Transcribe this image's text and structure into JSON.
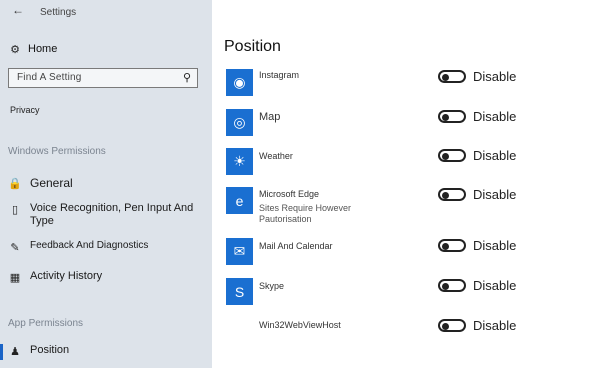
{
  "window": {
    "title": "Settings"
  },
  "sidebar": {
    "home_label": "Home",
    "search_placeholder": "Find A Setting",
    "privacy_label": "Privacy",
    "windows_permissions_header": "Windows Permissions",
    "app_permissions_header": "App Permissions",
    "items": [
      {
        "label": "General"
      },
      {
        "label": "Voice Recognition, Pen Input And Type"
      },
      {
        "label": "Feedback And Diagnostics"
      },
      {
        "label": "Activity History"
      },
      {
        "label": "Position"
      }
    ]
  },
  "main": {
    "title": "Position",
    "apps": [
      {
        "name": "Instagram",
        "state": "Disable",
        "icon": "instagram-icon"
      },
      {
        "name": "Map",
        "state": "Disable",
        "icon": "map-icon"
      },
      {
        "name": "Weather",
        "state": "Disable",
        "icon": "weather-icon"
      },
      {
        "name": "Microsoft Edge",
        "sub": "Sites Require However Pautorisation",
        "state": "Disable",
        "icon": "edge-icon"
      },
      {
        "name": "Mail And Calendar",
        "state": "Disable",
        "icon": "mail-icon"
      },
      {
        "name": "Skype",
        "state": "Disable",
        "icon": "skype-icon"
      },
      {
        "name": "Win32WebViewHost",
        "state": "Disable"
      }
    ]
  },
  "colors": {
    "accent": "#1a64c7",
    "app_icon_bg": "#1a6fd1",
    "sidebar_bg": "#dde3ea"
  }
}
